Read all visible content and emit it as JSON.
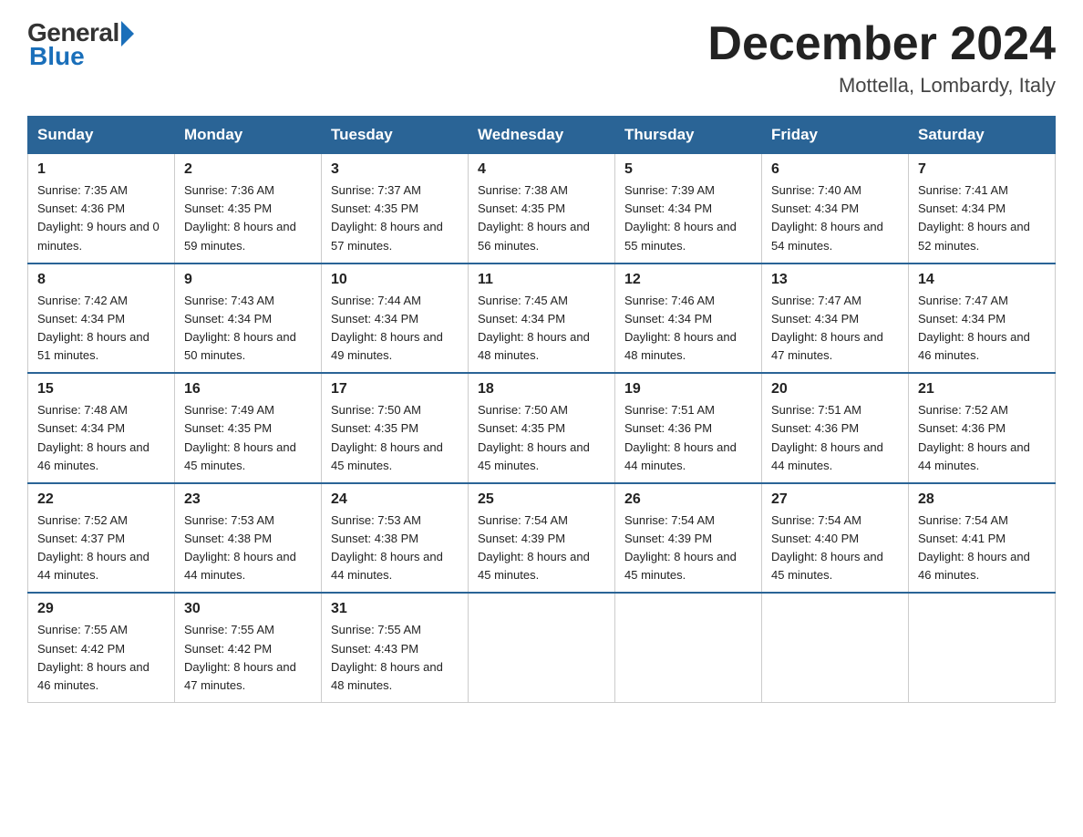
{
  "logo": {
    "general": "General",
    "blue": "Blue"
  },
  "title": "December 2024",
  "location": "Mottella, Lombardy, Italy",
  "headers": [
    "Sunday",
    "Monday",
    "Tuesday",
    "Wednesday",
    "Thursday",
    "Friday",
    "Saturday"
  ],
  "weeks": [
    [
      {
        "day": "1",
        "sunrise": "7:35 AM",
        "sunset": "4:36 PM",
        "daylight": "9 hours and 0 minutes."
      },
      {
        "day": "2",
        "sunrise": "7:36 AM",
        "sunset": "4:35 PM",
        "daylight": "8 hours and 59 minutes."
      },
      {
        "day": "3",
        "sunrise": "7:37 AM",
        "sunset": "4:35 PM",
        "daylight": "8 hours and 57 minutes."
      },
      {
        "day": "4",
        "sunrise": "7:38 AM",
        "sunset": "4:35 PM",
        "daylight": "8 hours and 56 minutes."
      },
      {
        "day": "5",
        "sunrise": "7:39 AM",
        "sunset": "4:34 PM",
        "daylight": "8 hours and 55 minutes."
      },
      {
        "day": "6",
        "sunrise": "7:40 AM",
        "sunset": "4:34 PM",
        "daylight": "8 hours and 54 minutes."
      },
      {
        "day": "7",
        "sunrise": "7:41 AM",
        "sunset": "4:34 PM",
        "daylight": "8 hours and 52 minutes."
      }
    ],
    [
      {
        "day": "8",
        "sunrise": "7:42 AM",
        "sunset": "4:34 PM",
        "daylight": "8 hours and 51 minutes."
      },
      {
        "day": "9",
        "sunrise": "7:43 AM",
        "sunset": "4:34 PM",
        "daylight": "8 hours and 50 minutes."
      },
      {
        "day": "10",
        "sunrise": "7:44 AM",
        "sunset": "4:34 PM",
        "daylight": "8 hours and 49 minutes."
      },
      {
        "day": "11",
        "sunrise": "7:45 AM",
        "sunset": "4:34 PM",
        "daylight": "8 hours and 48 minutes."
      },
      {
        "day": "12",
        "sunrise": "7:46 AM",
        "sunset": "4:34 PM",
        "daylight": "8 hours and 48 minutes."
      },
      {
        "day": "13",
        "sunrise": "7:47 AM",
        "sunset": "4:34 PM",
        "daylight": "8 hours and 47 minutes."
      },
      {
        "day": "14",
        "sunrise": "7:47 AM",
        "sunset": "4:34 PM",
        "daylight": "8 hours and 46 minutes."
      }
    ],
    [
      {
        "day": "15",
        "sunrise": "7:48 AM",
        "sunset": "4:34 PM",
        "daylight": "8 hours and 46 minutes."
      },
      {
        "day": "16",
        "sunrise": "7:49 AM",
        "sunset": "4:35 PM",
        "daylight": "8 hours and 45 minutes."
      },
      {
        "day": "17",
        "sunrise": "7:50 AM",
        "sunset": "4:35 PM",
        "daylight": "8 hours and 45 minutes."
      },
      {
        "day": "18",
        "sunrise": "7:50 AM",
        "sunset": "4:35 PM",
        "daylight": "8 hours and 45 minutes."
      },
      {
        "day": "19",
        "sunrise": "7:51 AM",
        "sunset": "4:36 PM",
        "daylight": "8 hours and 44 minutes."
      },
      {
        "day": "20",
        "sunrise": "7:51 AM",
        "sunset": "4:36 PM",
        "daylight": "8 hours and 44 minutes."
      },
      {
        "day": "21",
        "sunrise": "7:52 AM",
        "sunset": "4:36 PM",
        "daylight": "8 hours and 44 minutes."
      }
    ],
    [
      {
        "day": "22",
        "sunrise": "7:52 AM",
        "sunset": "4:37 PM",
        "daylight": "8 hours and 44 minutes."
      },
      {
        "day": "23",
        "sunrise": "7:53 AM",
        "sunset": "4:38 PM",
        "daylight": "8 hours and 44 minutes."
      },
      {
        "day": "24",
        "sunrise": "7:53 AM",
        "sunset": "4:38 PM",
        "daylight": "8 hours and 44 minutes."
      },
      {
        "day": "25",
        "sunrise": "7:54 AM",
        "sunset": "4:39 PM",
        "daylight": "8 hours and 45 minutes."
      },
      {
        "day": "26",
        "sunrise": "7:54 AM",
        "sunset": "4:39 PM",
        "daylight": "8 hours and 45 minutes."
      },
      {
        "day": "27",
        "sunrise": "7:54 AM",
        "sunset": "4:40 PM",
        "daylight": "8 hours and 45 minutes."
      },
      {
        "day": "28",
        "sunrise": "7:54 AM",
        "sunset": "4:41 PM",
        "daylight": "8 hours and 46 minutes."
      }
    ],
    [
      {
        "day": "29",
        "sunrise": "7:55 AM",
        "sunset": "4:42 PM",
        "daylight": "8 hours and 46 minutes."
      },
      {
        "day": "30",
        "sunrise": "7:55 AM",
        "sunset": "4:42 PM",
        "daylight": "8 hours and 47 minutes."
      },
      {
        "day": "31",
        "sunrise": "7:55 AM",
        "sunset": "4:43 PM",
        "daylight": "8 hours and 48 minutes."
      },
      null,
      null,
      null,
      null
    ]
  ]
}
